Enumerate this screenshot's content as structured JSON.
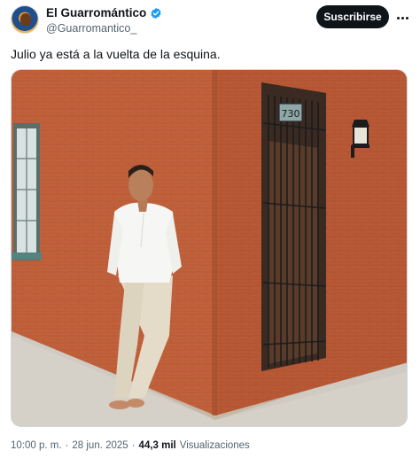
{
  "author": {
    "display_name": "El Guarromántico",
    "handle": "@Guarromantico_",
    "verified_color": "#1d9bf0"
  },
  "actions": {
    "subscribe_label": "Suscribirse",
    "more_icon": "more-horizontal-icon"
  },
  "tweet": {
    "text": "Julio ya está a la vuelta de la esquina."
  },
  "media": {
    "house_number": "730",
    "wall_color": "#c0603a"
  },
  "footer": {
    "time": "10:00 p. m.",
    "separator": "·",
    "date": "28 jun. 2025",
    "views_count": "44,3 mil",
    "views_label": "Visualizaciones"
  }
}
